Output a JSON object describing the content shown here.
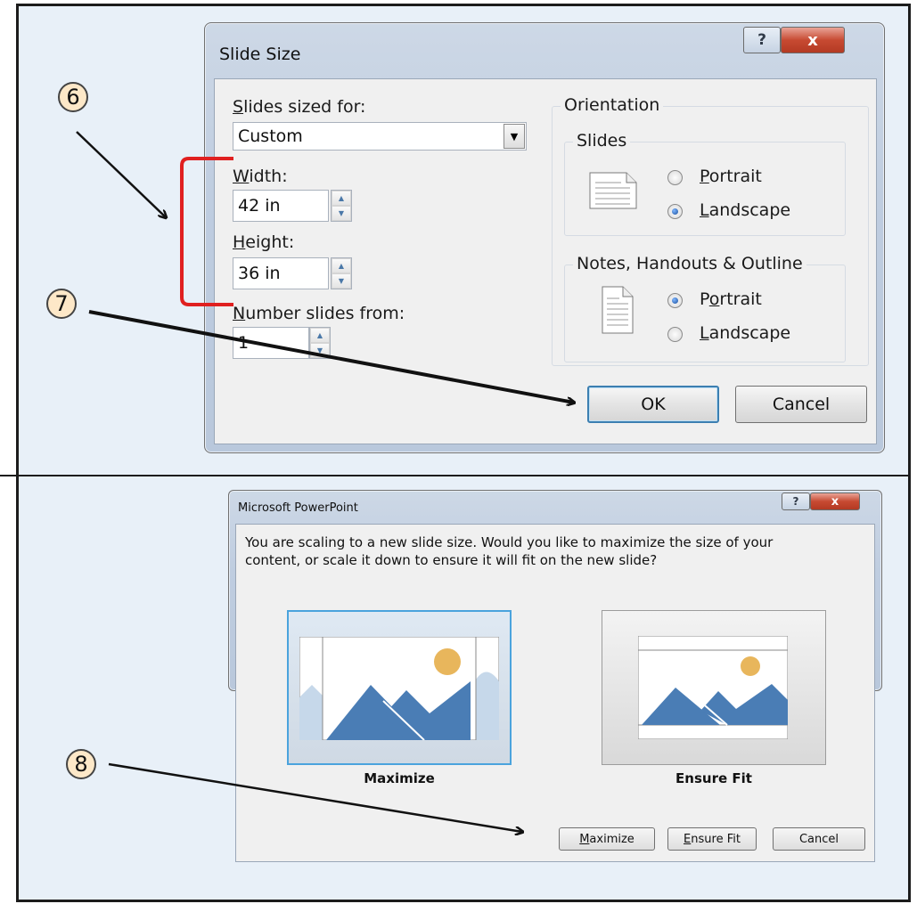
{
  "callouts": [
    "6",
    "7",
    "8"
  ],
  "slide_size_dialog": {
    "title": "Slide Size",
    "help_icon": "?",
    "close_icon": "x",
    "sized_for_label": "Slides sized for:",
    "sized_for_value": "Custom",
    "width_label": "Width:",
    "width_value": "42 in",
    "height_label": "Height:",
    "height_value": "36 in",
    "number_from_label": "Number slides from:",
    "number_from_value": "1",
    "orientation_label": "Orientation",
    "slides_group": "Slides",
    "slides_portrait": "Portrait",
    "slides_landscape": "Landscape",
    "slides_selected": "Landscape",
    "notes_group": "Notes, Handouts & Outline",
    "notes_portrait": "Portrait",
    "notes_landscape": "Landscape",
    "notes_selected": "Portrait",
    "ok_label": "OK",
    "cancel_label": "Cancel"
  },
  "scale_dialog": {
    "title": "Microsoft PowerPoint",
    "help_icon": "?",
    "close_icon": "x",
    "message_line1": "You are scaling to a new slide size.  Would you like to maximize the size of your",
    "message_line2": "content, or scale it down to ensure it will fit on the new slide?",
    "option_maximize": "Maximize",
    "option_ensure_fit": "Ensure Fit",
    "selected_option": "Maximize",
    "maximize_button": "Maximize",
    "ensure_fit_button": "Ensure Fit",
    "cancel_button": "Cancel"
  },
  "colors": {
    "annotation_bracket": "#e02020",
    "illustration_blue": "#4a7db5",
    "illustration_sun": "#e8b65c",
    "illustration_light_blue": "#c6d8ea"
  }
}
